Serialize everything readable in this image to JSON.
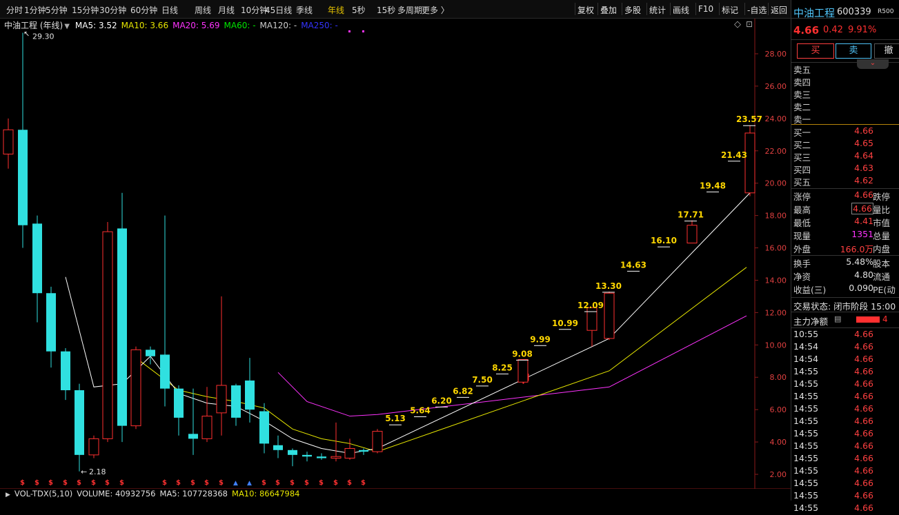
{
  "toolbar": {
    "periods": [
      "分时",
      "1分钟",
      "5分钟",
      "15分钟",
      "30分钟",
      "60分钟",
      "日线",
      "周线",
      "月线",
      "10分钟",
      "45日线",
      "季线",
      "年线",
      "5秒",
      "15秒",
      "多周期",
      "更多 〉"
    ],
    "active_period": "年线",
    "right_items": [
      "复权",
      "叠加",
      "多股",
      "统计",
      "画线",
      "F10",
      "标记",
      "-自选",
      "返回"
    ]
  },
  "legend": {
    "title": "中油工程 (年线)",
    "ma5": "MA5: 3.52",
    "ma10": "MA10: 3.66",
    "ma20": "MA20: 5.69",
    "ma60": "MA60: -",
    "ma120": "MA120: -",
    "ma250": "MA250: -",
    "colors": {
      "ma5": "#ffffff",
      "ma10": "#e6e600",
      "ma20": "#ff33ff",
      "ma60": "#00e600",
      "ma120": "#cccccc",
      "ma250": "#3333ff"
    }
  },
  "volume_bar": {
    "label": "VOL-TDX(5,10)",
    "volume": "VOLUME: 40932756",
    "ma5": "MA5: 107728368",
    "ma10": "MA10: 86647984"
  },
  "chart_data": {
    "type": "candlestick",
    "ylim": [
      1.5,
      30.5
    ],
    "yticks": [
      "28.00",
      "26.00",
      "24.00",
      "22.00",
      "20.00",
      "18.00",
      "16.00",
      "14.00",
      "12.00",
      "10.00",
      "8.00",
      "6.00",
      "4.00",
      "2.00"
    ],
    "high_label": "29.30",
    "low_label": "2.18",
    "candles": [
      {
        "o": 21.8,
        "c": 23.3,
        "h": 24.0,
        "l": 20.9
      },
      {
        "o": 23.3,
        "c": 17.4,
        "h": 29.3,
        "l": 16.0
      },
      {
        "o": 17.5,
        "c": 13.2,
        "h": 18.0,
        "l": 11.4
      },
      {
        "o": 13.2,
        "c": 9.6,
        "h": 13.6,
        "l": 8.6
      },
      {
        "o": 9.6,
        "c": 7.2,
        "h": 9.8,
        "l": 6.6
      },
      {
        "o": 7.2,
        "c": 3.2,
        "h": 7.6,
        "l": 2.18
      },
      {
        "o": 3.2,
        "c": 4.2,
        "h": 4.4,
        "l": 3.0
      },
      {
        "o": 4.2,
        "c": 17.0,
        "h": 17.6,
        "l": 4.0
      },
      {
        "o": 17.2,
        "c": 5.0,
        "h": 19.4,
        "l": 4.0
      },
      {
        "o": 5.0,
        "c": 9.7,
        "h": 9.9,
        "l": 4.8
      },
      {
        "o": 9.7,
        "c": 9.3,
        "h": 9.9,
        "l": 8.8
      },
      {
        "o": 9.4,
        "c": 7.3,
        "h": 18.0,
        "l": 6.2
      },
      {
        "o": 7.3,
        "c": 5.5,
        "h": 7.5,
        "l": 4.4
      },
      {
        "o": 4.5,
        "c": 4.2,
        "h": 7.3,
        "l": 3.2
      },
      {
        "o": 4.2,
        "c": 5.6,
        "h": 7.4,
        "l": 4.0
      },
      {
        "o": 5.8,
        "c": 7.5,
        "h": 13.0,
        "l": 4.4
      },
      {
        "o": 7.5,
        "c": 5.5,
        "h": 7.6,
        "l": 5.0
      },
      {
        "o": 7.8,
        "c": 6.0,
        "h": 9.2,
        "l": 5.2
      },
      {
        "o": 5.9,
        "c": 3.9,
        "h": 6.4,
        "l": 3.3
      },
      {
        "o": 3.8,
        "c": 3.5,
        "h": 4.4,
        "l": 3.0
      },
      {
        "o": 3.5,
        "c": 3.2,
        "h": 3.6,
        "l": 2.5
      },
      {
        "o": 3.2,
        "c": 3.1,
        "h": 3.4,
        "l": 2.8
      },
      {
        "o": 3.1,
        "c": 3.0,
        "h": 3.3,
        "l": 2.9
      },
      {
        "o": 3.0,
        "c": 3.1,
        "h": 5.2,
        "l": 2.8
      },
      {
        "o": 3.0,
        "c": 3.6,
        "h": 4.2,
        "l": 2.9
      },
      {
        "o": 3.5,
        "c": 3.4,
        "h": 3.6,
        "l": 3.2
      },
      {
        "o": 3.4,
        "c": 4.66,
        "h": 4.8,
        "l": 3.3
      },
      {
        "o": 7.8,
        "c": 8.2,
        "h": 8.3,
        "l": 7.6
      },
      {
        "o": 7.7,
        "c": 9.1,
        "h": 9.1,
        "l": 7.6
      },
      {
        "o": 10.9,
        "c": 12.3,
        "h": 12.3,
        "l": 9.9
      },
      {
        "o": 10.4,
        "c": 13.2,
        "h": 13.3,
        "l": 10.3
      },
      {
        "o": 16.3,
        "c": 17.4,
        "h": 17.7,
        "l": 16.3
      },
      {
        "o": 19.4,
        "c": 23.1,
        "h": 23.57,
        "l": 19.2
      }
    ],
    "candle_x": [
      12,
      33,
      54,
      74,
      95,
      115,
      136,
      156,
      177,
      197,
      218,
      239,
      259,
      280,
      300,
      321,
      342,
      362,
      383,
      403,
      424,
      445,
      466,
      487,
      507,
      527,
      547,
      759,
      758,
      858,
      883,
      1003,
      1087
    ],
    "candle_colors": [
      "up",
      "down",
      "down",
      "down",
      "down",
      "down",
      "up",
      "up",
      "down",
      "up",
      "down",
      "down",
      "down",
      "down",
      "up",
      "up",
      "down",
      "down",
      "down",
      "down",
      "down",
      "down",
      "down",
      "up",
      "up",
      "down",
      "up",
      "down",
      "up",
      "down",
      "up",
      "up",
      "down"
    ],
    "step_labels": [
      {
        "text": "5.13",
        "x": 573,
        "y": 5.4
      },
      {
        "text": "5.64",
        "x": 609,
        "y": 5.9
      },
      {
        "text": "6.20",
        "x": 640,
        "y": 6.5
      },
      {
        "text": "6.82",
        "x": 671,
        "y": 7.1
      },
      {
        "text": "7.50",
        "x": 699,
        "y": 7.8
      },
      {
        "text": "8.25",
        "x": 728,
        "y": 8.55
      },
      {
        "text": "9.08",
        "x": 757,
        "y": 9.4
      },
      {
        "text": "9.99",
        "x": 783,
        "y": 10.3
      },
      {
        "text": "10.99",
        "x": 819,
        "y": 11.3
      },
      {
        "text": "12.09",
        "x": 856,
        "y": 12.4
      },
      {
        "text": "13.30",
        "x": 882,
        "y": 13.6
      },
      {
        "text": "14.63",
        "x": 918,
        "y": 14.9
      },
      {
        "text": "16.10",
        "x": 962,
        "y": 16.4
      },
      {
        "text": "17.71",
        "x": 1001,
        "y": 18.0
      },
      {
        "text": "19.48",
        "x": 1033,
        "y": 19.8
      },
      {
        "text": "21.43",
        "x": 1064,
        "y": 21.7
      },
      {
        "text": "23.57",
        "x": 1086,
        "y": 23.9
      }
    ],
    "ma5_line": [
      [
        95,
        14.2
      ],
      [
        136,
        7.4
      ],
      [
        177,
        7.6
      ],
      [
        218,
        9.3
      ],
      [
        259,
        7.0
      ],
      [
        300,
        6.4
      ],
      [
        342,
        6.2
      ],
      [
        383,
        5.3
      ],
      [
        424,
        4.2
      ],
      [
        466,
        3.6
      ],
      [
        507,
        3.3
      ],
      [
        547,
        3.6
      ],
      [
        883,
        10.4
      ],
      [
        1087,
        19.4
      ]
    ],
    "ma10_line": [
      [
        197,
        9.2
      ],
      [
        259,
        7.2
      ],
      [
        300,
        6.8
      ],
      [
        342,
        6.5
      ],
      [
        383,
        6.1
      ],
      [
        424,
        4.8
      ],
      [
        466,
        4.2
      ],
      [
        507,
        3.9
      ],
      [
        547,
        3.4
      ],
      [
        883,
        8.4
      ],
      [
        1082,
        14.8
      ]
    ],
    "ma20_line": [
      [
        403,
        8.3
      ],
      [
        445,
        6.5
      ],
      [
        507,
        5.6
      ],
      [
        547,
        5.7
      ],
      [
        883,
        7.4
      ],
      [
        1082,
        11.8
      ]
    ]
  },
  "right_panel": {
    "stock_name": "中油工程",
    "stock_code": "600339",
    "price": "4.66",
    "change": "0.42",
    "change_pct": "9.91%",
    "tag": "R500",
    "buttons": {
      "buy": "买",
      "sell": "卖",
      "cancel": "撤"
    },
    "sell_levels": [
      "卖五",
      "卖四",
      "卖三",
      "卖二",
      "卖一"
    ],
    "buy_levels": [
      {
        "label": "买一",
        "val": "4.66"
      },
      {
        "label": "买二",
        "val": "4.65"
      },
      {
        "label": "买三",
        "val": "4.64"
      },
      {
        "label": "买四",
        "val": "4.63"
      },
      {
        "label": "买五",
        "val": "4.62"
      }
    ],
    "stats": [
      {
        "l1": "涨停",
        "v": "4.66",
        "l2": "跌停"
      },
      {
        "l1": "最高",
        "v": "4.66",
        "l2": "量比"
      },
      {
        "l1": "最低",
        "v": "4.41",
        "l2": "市值"
      },
      {
        "l1": "现量",
        "v": "1351",
        "l2": "总量"
      },
      {
        "l1": "外盘",
        "v": "166.0万",
        "l2": "内盘"
      }
    ],
    "stats2": [
      {
        "l1": "换手",
        "v": "5.48%",
        "l2": "股本"
      },
      {
        "l1": "净资",
        "v": "4.80",
        "l2": "流通"
      },
      {
        "l1": "收益(三)",
        "v": "0.090",
        "l2": "PE(动"
      }
    ],
    "trade_status": "交易状态: 闭市阶段 15:00",
    "main_net": "主力净额",
    "main_net_val": "4",
    "ticks": [
      {
        "t": "10:55",
        "v": "4.66"
      },
      {
        "t": "14:54",
        "v": "4.66"
      },
      {
        "t": "14:54",
        "v": "4.66"
      },
      {
        "t": "14:55",
        "v": "4.66"
      },
      {
        "t": "14:55",
        "v": "4.66"
      },
      {
        "t": "14:55",
        "v": "4.66"
      },
      {
        "t": "14:55",
        "v": "4.66"
      },
      {
        "t": "14:55",
        "v": "4.66"
      },
      {
        "t": "14:55",
        "v": "4.66"
      },
      {
        "t": "14:55",
        "v": "4.66"
      },
      {
        "t": "14:55",
        "v": "4.66"
      },
      {
        "t": "14:55",
        "v": "4.66"
      },
      {
        "t": "14:55",
        "v": "4.66"
      },
      {
        "t": "14:55",
        "v": "4.66"
      },
      {
        "t": "14:55",
        "v": "4.66"
      }
    ]
  }
}
